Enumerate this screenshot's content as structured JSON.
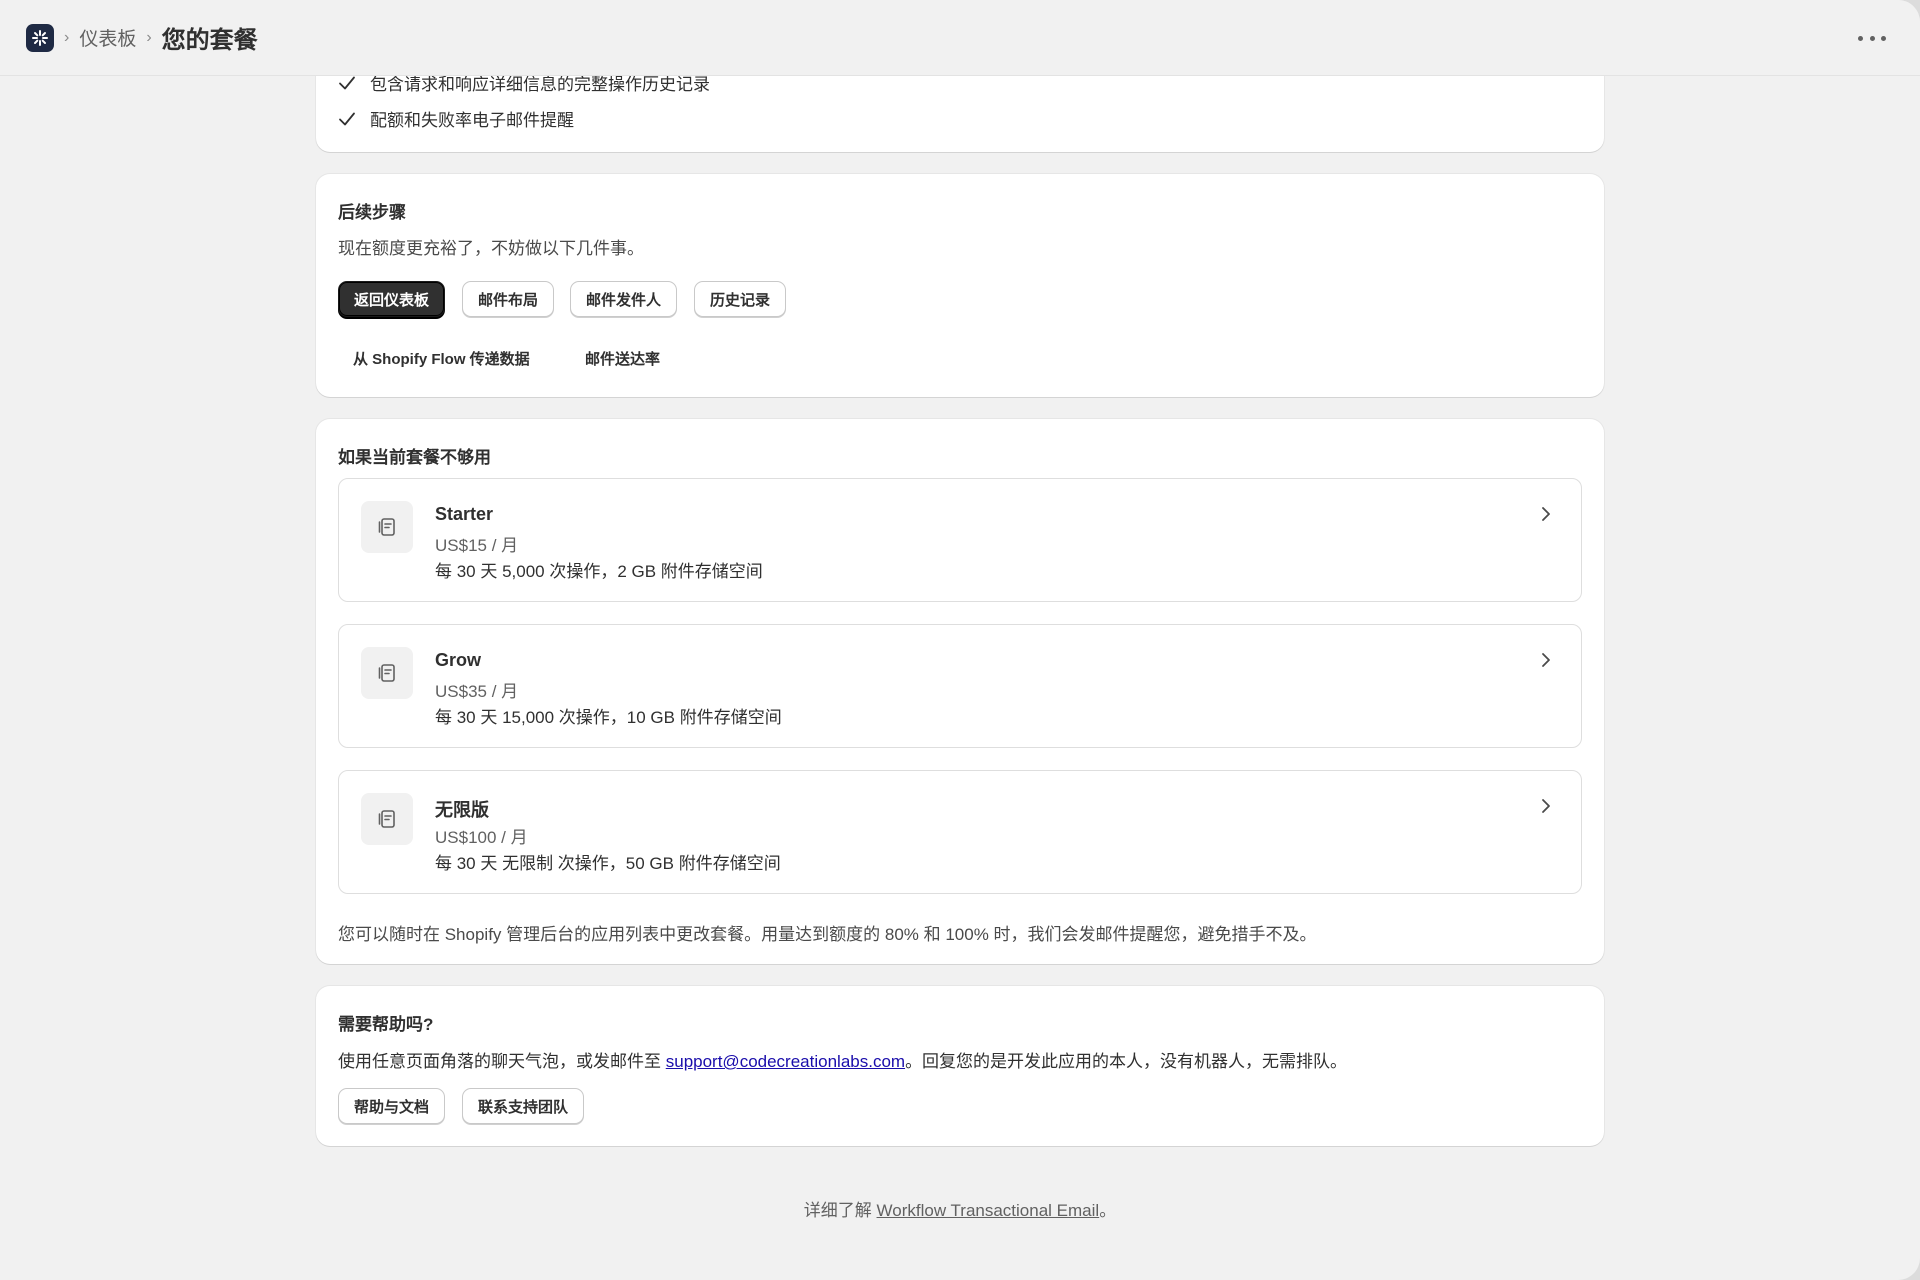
{
  "topbar": {
    "app_logo": "app-logo",
    "breadcrumb_parent": "仪表板",
    "breadcrumb_current": "您的套餐",
    "more_icon": "more-horizontal-icon"
  },
  "features_tail": [
    "包含请求和响应详细信息的完整操作历史记录",
    "配额和失败率电子邮件提醒"
  ],
  "next_steps": {
    "title": "后续步骤",
    "subtitle": "现在额度更充裕了，不妨做以下几件事。",
    "buttons": [
      "返回仪表板",
      "邮件布局",
      "邮件发件人",
      "历史记录"
    ],
    "plain_buttons": [
      "从 Shopify Flow 传递数据",
      "邮件送达率"
    ]
  },
  "upgrade": {
    "title": "如果当前套餐不够用",
    "plans": [
      {
        "name": "Starter",
        "price": "US$15 / 月",
        "desc": "每 30 天 5,000 次操作，2 GB 附件存储空间"
      },
      {
        "name": "Grow",
        "price": "US$35 / 月",
        "desc": "每 30 天 15,000 次操作，10 GB 附件存储空间"
      },
      {
        "name": "无限版",
        "price": "US$100 / 月",
        "desc": "每 30 天 无限制 次操作，50 GB 附件存储空间"
      }
    ],
    "note": "您可以随时在 Shopify 管理后台的应用列表中更改套餐。用量达到额度的 80% 和 100% 时，我们会发邮件提醒您，避免措手不及。"
  },
  "help": {
    "title": "需要帮助吗?",
    "text_before": "使用任意页面角落的聊天气泡，或发邮件至 ",
    "email": "support@codecreationlabs.com",
    "text_after": "。回复您的是开发此应用的本人，没有机器人，无需排队。",
    "buttons": [
      "帮助与文档",
      "联系支持团队"
    ]
  },
  "footer": {
    "prefix": "详细了解 ",
    "link": "Workflow Transactional Email",
    "suffix": "。"
  },
  "colors": {
    "background": "#f1f1f1",
    "card": "#ffffff",
    "primary_button": "#303030",
    "logo_bg": "#1f2a44"
  }
}
